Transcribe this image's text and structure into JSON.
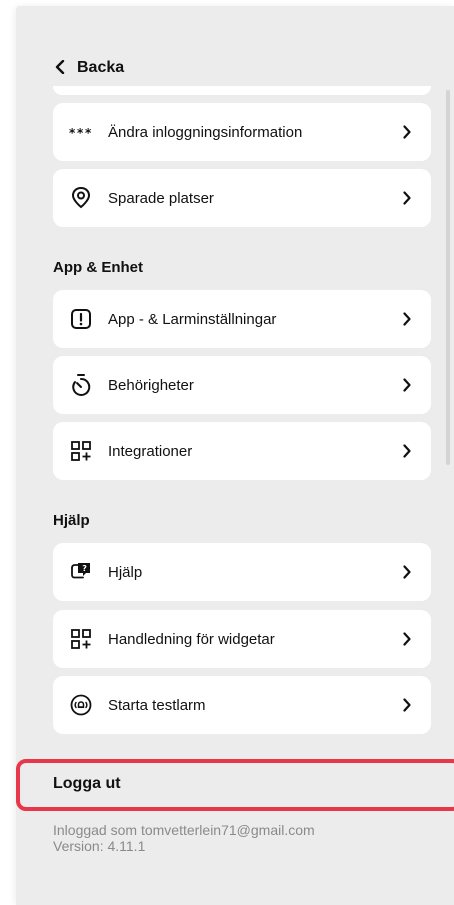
{
  "header": {
    "back_label": "Backa"
  },
  "account": {
    "items": [
      {
        "icon": "asterisks-icon",
        "label": "Ändra inloggningsinformation"
      },
      {
        "icon": "location-pin-icon",
        "label": "Sparade platser"
      }
    ]
  },
  "app_device": {
    "title": "App & Enhet",
    "items": [
      {
        "icon": "alert-box-icon",
        "label": "App - & Larminställningar"
      },
      {
        "icon": "timer-icon",
        "label": "Behörigheter"
      },
      {
        "icon": "grid-plus-icon",
        "label": "Integrationer"
      }
    ]
  },
  "help": {
    "title": "Hjälp",
    "items": [
      {
        "icon": "help-chat-icon",
        "label": "Hjälp"
      },
      {
        "icon": "grid-plus-icon",
        "label": "Handledning för widgetar"
      },
      {
        "icon": "alarm-sound-icon",
        "label": "Starta testlarm"
      }
    ]
  },
  "footer": {
    "logout_label": "Logga ut",
    "logged_in_as": "Inloggad som tomvetterlein71@gmail.com",
    "version": "Version: 4.11.1"
  },
  "colors": {
    "highlight": "#e8364a",
    "background": "#ececec",
    "card": "#ffffff"
  }
}
